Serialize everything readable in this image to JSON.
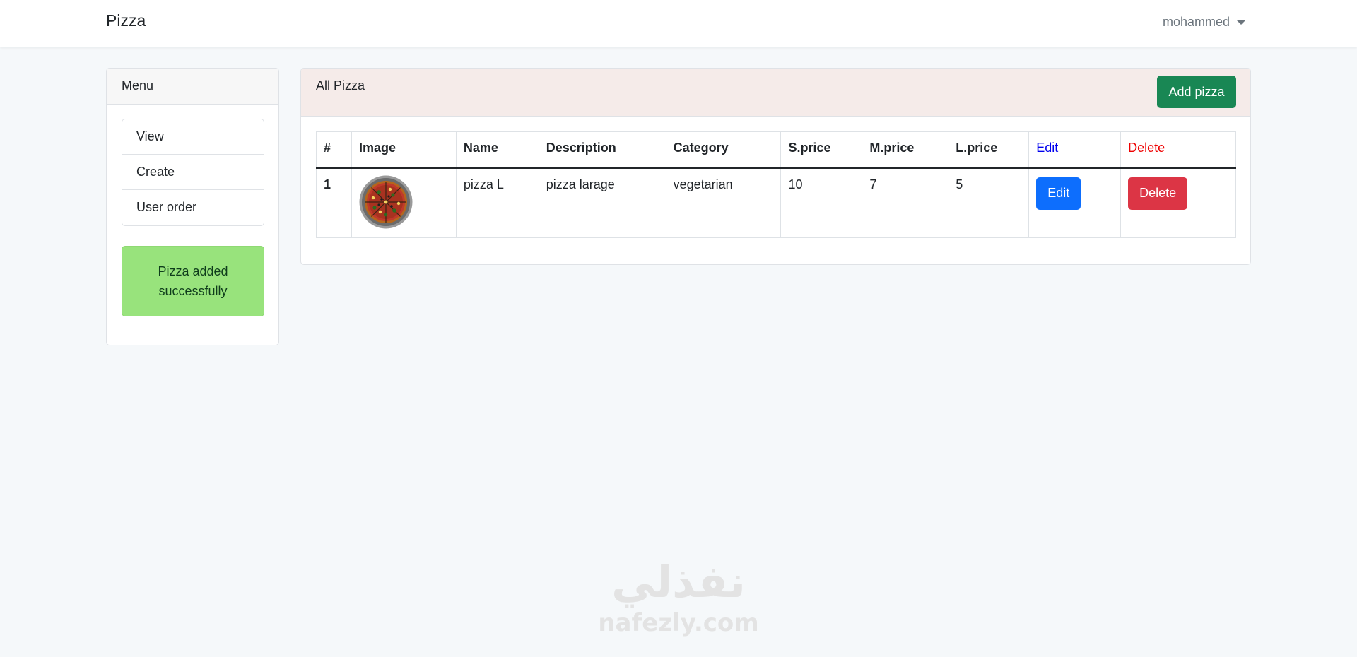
{
  "navbar": {
    "brand": "Pizza",
    "user": "mohammed",
    "dropdown_icon": "caret-down-icon"
  },
  "sidebar": {
    "title": "Menu",
    "items": [
      {
        "label": "View"
      },
      {
        "label": "Create"
      },
      {
        "label": "User order"
      }
    ],
    "alert": "Pizza added successfully",
    "alert_color": "#98e37c"
  },
  "main": {
    "title": "All Pizza",
    "add_button": "Add pizza",
    "table": {
      "headers": [
        "#",
        "Image",
        "Name",
        "Description",
        "Category",
        "S.price",
        "M.price",
        "L.price",
        "Edit",
        "Delete"
      ],
      "rows": [
        {
          "num": "1",
          "image": "pizza-image",
          "name": "pizza L",
          "description": "pizza larage",
          "category": "vegetarian",
          "s_price": "10",
          "m_price": "7",
          "l_price": "5",
          "edit": "Edit",
          "delete": "Delete"
        }
      ]
    }
  },
  "colors": {
    "add_button": "#198754",
    "edit_button": "#0d6efd",
    "delete_button": "#dc3545",
    "header_bg": "#f5ebe9"
  },
  "watermark": {
    "arabic": "نفذلي",
    "latin": "nafezly.com"
  }
}
